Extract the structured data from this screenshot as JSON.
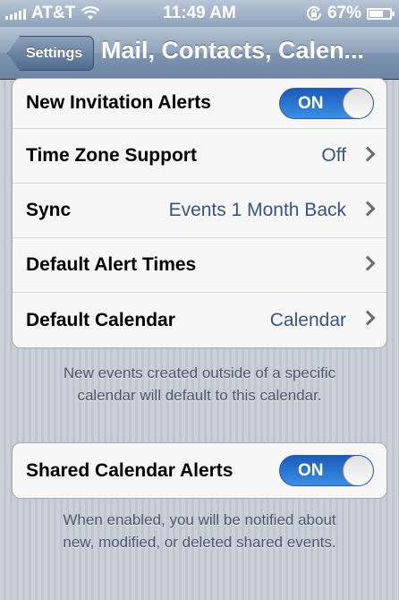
{
  "status_bar": {
    "carrier": "AT&T",
    "time": "11:49 AM",
    "battery_percent": "67%",
    "battery_level": 0.67,
    "icons": [
      "signal-bars-icon",
      "wifi-icon",
      "rotation-lock-icon",
      "battery-icon"
    ]
  },
  "navbar": {
    "back_label": "Settings",
    "title": "Mail, Contacts, Calen..."
  },
  "calendar_settings": {
    "rows": [
      {
        "label": "New Invitation Alerts",
        "toggle": "ON"
      },
      {
        "label": "Time Zone Support",
        "value": "Off"
      },
      {
        "label": "Sync",
        "value": "Events 1 Month Back"
      },
      {
        "label": "Default Alert Times",
        "value": ""
      },
      {
        "label": "Default Calendar",
        "value": "Calendar"
      }
    ],
    "footnote_lines": [
      "New events created outside of a specific",
      "calendar will default to this calendar."
    ]
  },
  "shared_settings": {
    "label": "Shared Calendar Alerts",
    "toggle": "ON",
    "footnote_lines": [
      "When enabled, you will be notified about",
      "new, modified, or deleted shared events."
    ]
  },
  "colors": {
    "toggle_on": "#2a78d6",
    "value_text": "#385487",
    "background": "#c5ccd4"
  }
}
